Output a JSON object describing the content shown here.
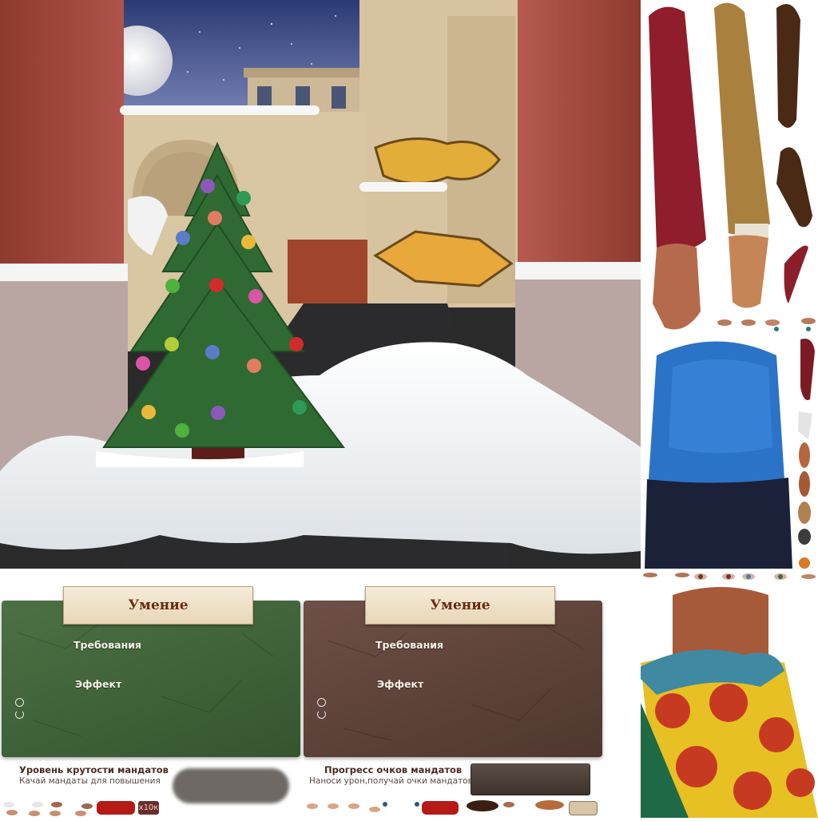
{
  "skill_cards": [
    {
      "title": "Умение",
      "requirements_label": "Требования",
      "effect_label": "Эффект",
      "color": "#3f6238",
      "time_icon": "clock-icon",
      "cooldown_icon": "refresh-icon"
    },
    {
      "title": "Умение",
      "requirements_label": "Требования",
      "effect_label": "Эффект",
      "color": "#5d4239",
      "time_icon": "clock-icon",
      "cooldown_icon": "refresh-icon"
    }
  ],
  "progress_bars": {
    "coolness": {
      "title": "Уровень крутости мандатов",
      "subtitle": "Качай мандаты для повышения"
    },
    "mandate_points": {
      "title": "Прогресс очков мандатов",
      "subtitle": "Наноси урон,получай очки мандатов"
    }
  },
  "multiplier_badge": "x10к",
  "colors": {
    "accent_red": "#b51a14",
    "plank": "#efe2c8",
    "plank_text": "#6a2b12"
  }
}
